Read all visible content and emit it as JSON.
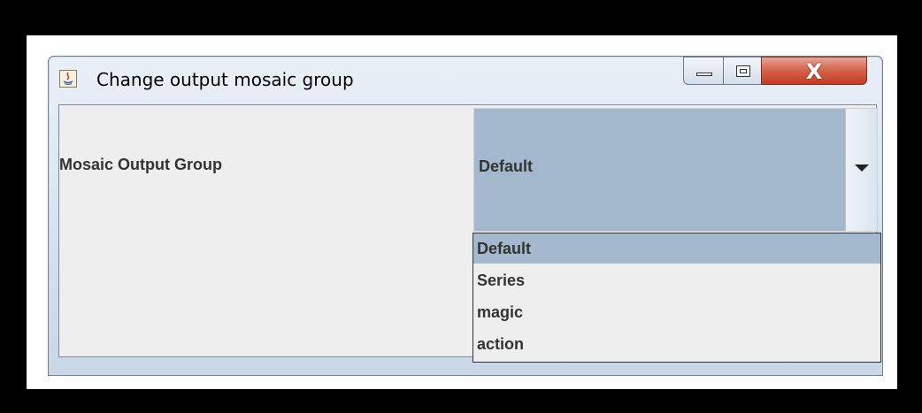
{
  "window": {
    "title": "Change output mosaic group",
    "close_glyph": "X",
    "icon": "java-app-icon"
  },
  "form": {
    "label": "Mosaic Output Group",
    "selected_value": "Default",
    "dropdown_icon": "chevron-down-icon"
  },
  "dropdown": {
    "options": [
      {
        "label": "Default",
        "selected": true
      },
      {
        "label": "Series",
        "selected": false
      },
      {
        "label": "magic",
        "selected": false
      },
      {
        "label": "action",
        "selected": false
      }
    ]
  },
  "colors": {
    "selection": "#a3b8cc",
    "panel_background": "#eeeeee",
    "close_button": "#c43b22"
  }
}
